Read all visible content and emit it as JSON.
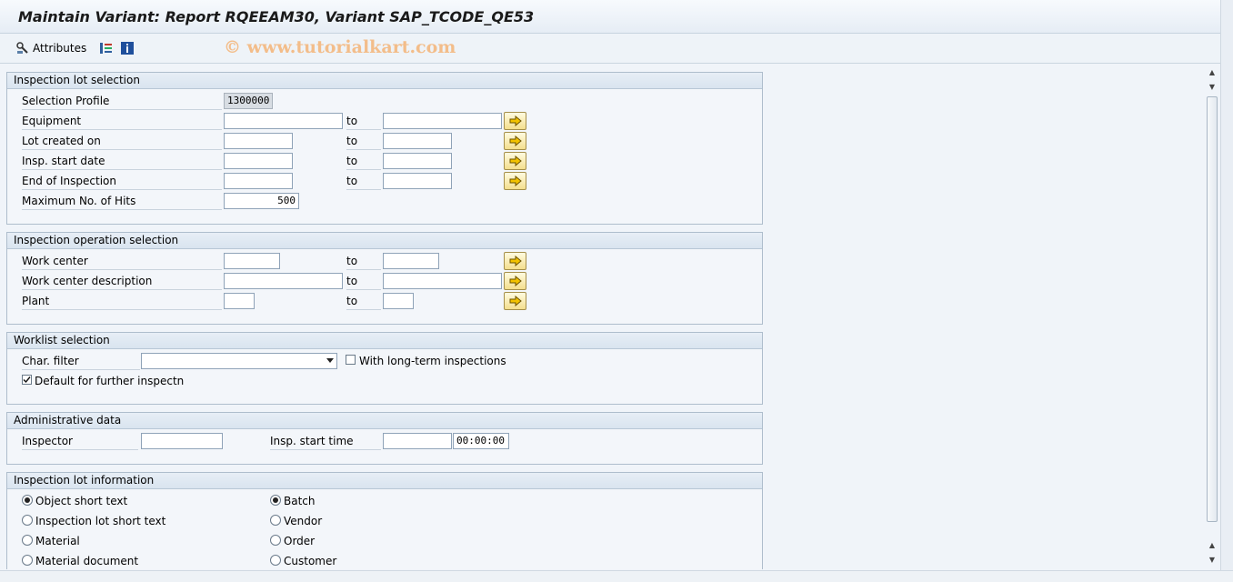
{
  "window": {
    "title": "Maintain Variant: Report RQEEAM30, Variant SAP_TCODE_QE53"
  },
  "toolbar": {
    "attributes_label": "Attributes",
    "watermark": "© www.tutorialkart.com"
  },
  "inspection_lot_selection": {
    "heading": "Inspection lot selection",
    "selection_profile": {
      "label": "Selection Profile",
      "value": "1300000"
    },
    "equipment": {
      "label": "Equipment",
      "to": "to",
      "from_value": "",
      "to_value": ""
    },
    "lot_created_on": {
      "label": "Lot created on",
      "to": "to",
      "from_value": "",
      "to_value": ""
    },
    "insp_start_date": {
      "label": "Insp. start date",
      "to": "to",
      "from_value": "",
      "to_value": ""
    },
    "end_of_inspection": {
      "label": "End of Inspection",
      "to": "to",
      "from_value": "",
      "to_value": ""
    },
    "max_hits": {
      "label": "Maximum No. of Hits",
      "value": "500"
    }
  },
  "inspection_operation_selection": {
    "heading": "Inspection operation selection",
    "work_center": {
      "label": "Work center",
      "to": "to",
      "from_value": "",
      "to_value": ""
    },
    "work_center_description": {
      "label": "Work center description",
      "to": "to",
      "from_value": "",
      "to_value": ""
    },
    "plant": {
      "label": "Plant",
      "to": "to",
      "from_value": "",
      "to_value": ""
    }
  },
  "worklist_selection": {
    "heading": "Worklist selection",
    "char_filter": {
      "label": "Char. filter",
      "value": ""
    },
    "long_term": {
      "label": "With long-term inspections",
      "checked": false
    },
    "default_further": {
      "label": "Default for further inspectn",
      "checked": true
    }
  },
  "administrative_data": {
    "heading": "Administrative data",
    "inspector": {
      "label": "Inspector",
      "value": ""
    },
    "insp_start_time": {
      "label": "Insp. start time",
      "date_value": "",
      "time_value": "00:00:00"
    }
  },
  "inspection_lot_information": {
    "heading": "Inspection lot information",
    "left_options": [
      "Object short text",
      "Inspection lot short text",
      "Material",
      "Material document"
    ],
    "right_options": [
      "Batch",
      "Vendor",
      "Order",
      "Customer"
    ],
    "left_selected": "Object short text",
    "right_selected": "Batch"
  },
  "colors": {
    "accent_button": "#f4df8e",
    "header": "#d9e4ef"
  }
}
